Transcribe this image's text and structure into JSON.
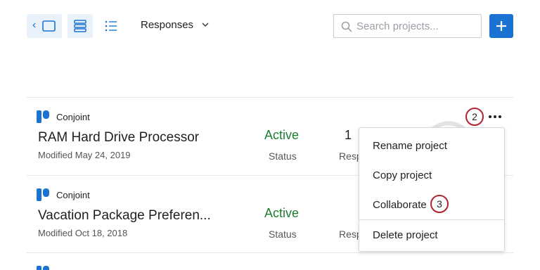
{
  "toolbar": {
    "collapse_chevron": "‹",
    "responses_label": "Responses",
    "search_placeholder": "Search projects...",
    "icons": [
      "panel-icon",
      "card-view-icon",
      "list-view-icon",
      "chevron-down-icon",
      "search-icon",
      "plus-icon"
    ]
  },
  "projects": [
    {
      "type": "Conjoint",
      "name": "RAM Hard Drive Processor",
      "modified": "Modified May 24, 2019",
      "status": "Active",
      "status_label": "Status",
      "responses_value": "1",
      "responses_label": "Resp"
    },
    {
      "type": "Conjoint",
      "name": "Vacation Package Preferen...",
      "modified": "Modified Oct 18, 2018",
      "status": "Active",
      "status_label": "Status",
      "responses_label": "Resp"
    }
  ],
  "callouts": {
    "more": "2",
    "collaborate": "3"
  },
  "menu": {
    "items": [
      "Rename project",
      "Copy project",
      "Collaborate",
      "Delete project"
    ]
  },
  "colors": {
    "accent": "#1a73d1",
    "active_green": "#1e7d32",
    "callout_red": "#b1232f",
    "conjoint_icon": "#1a73d1"
  }
}
